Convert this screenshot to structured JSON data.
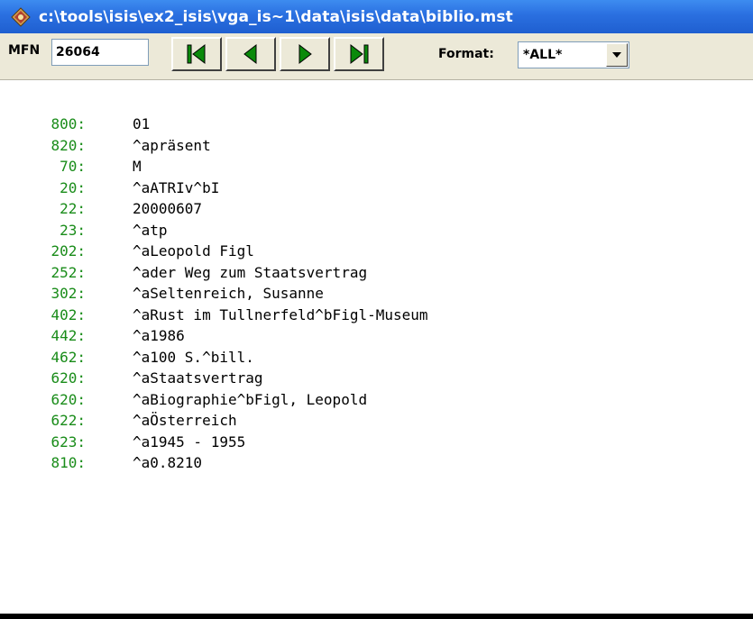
{
  "window": {
    "title": "c:\\tools\\isis\\ex2_isis\\vga_is~1\\data\\isis\\data\\biblio.mst"
  },
  "toolbar": {
    "mfn_label": "MFN",
    "mfn_value": "26064",
    "nav_buttons": [
      {
        "name": "first-record",
        "icon": "first-icon"
      },
      {
        "name": "previous-record",
        "icon": "previous-icon"
      },
      {
        "name": "next-record",
        "icon": "next-icon"
      },
      {
        "name": "last-record",
        "icon": "last-icon"
      }
    ],
    "format_label": "Format:",
    "format_value": "*ALL*"
  },
  "colors": {
    "title_bar": "#2a6fe0",
    "tag_color": "#198c19",
    "toolbar_bg": "#ece9d8",
    "nav_arrow": "#0b8a0b"
  },
  "record": [
    {
      "tag": "800:",
      "value": "01"
    },
    {
      "tag": "820:",
      "value": "^apräsent"
    },
    {
      "tag": "70:",
      "value": "M"
    },
    {
      "tag": "20:",
      "value": "^aATRIv^bI"
    },
    {
      "tag": "22:",
      "value": "20000607"
    },
    {
      "tag": "23:",
      "value": "^atp"
    },
    {
      "tag": "202:",
      "value": "^aLeopold Figl"
    },
    {
      "tag": "252:",
      "value": "^ader Weg zum Staatsvertrag"
    },
    {
      "tag": "302:",
      "value": "^aSeltenreich, Susanne"
    },
    {
      "tag": "402:",
      "value": "^aRust im Tullnerfeld^bFigl-Museum"
    },
    {
      "tag": "442:",
      "value": "^a1986"
    },
    {
      "tag": "462:",
      "value": "^a100 S.^bill."
    },
    {
      "tag": "620:",
      "value": "^aStaatsvertrag"
    },
    {
      "tag": "620:",
      "value": "^aBiographie^bFigl, Leopold"
    },
    {
      "tag": "622:",
      "value": "^aÖsterreich"
    },
    {
      "tag": "623:",
      "value": "^a1945 - 1955"
    },
    {
      "tag": "810:",
      "value": "^a0.8210"
    }
  ]
}
